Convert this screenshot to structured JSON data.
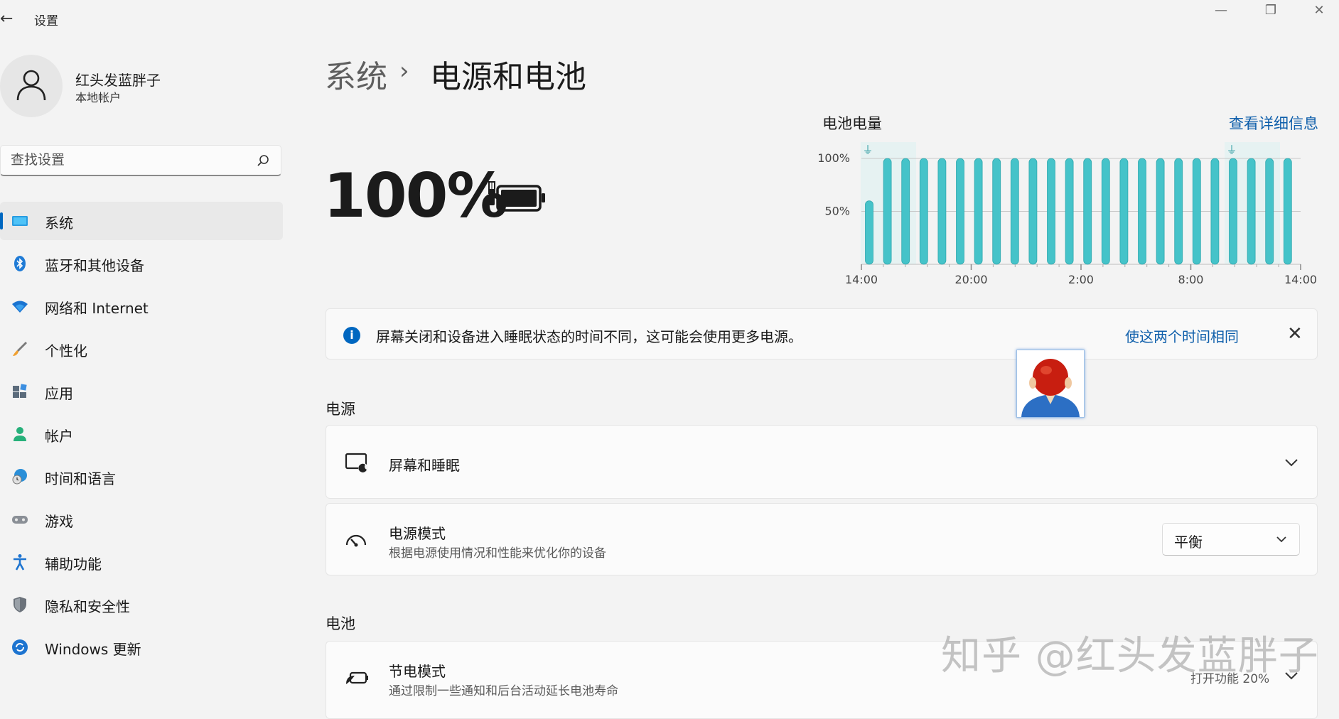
{
  "window": {
    "title": "设置",
    "back_glyph": "←",
    "minimize_glyph": "—",
    "restore_glyph": "❐",
    "close_glyph": "✕"
  },
  "user": {
    "name": "红头发蓝胖子",
    "account_type": "本地帐户"
  },
  "search": {
    "placeholder": "查找设置"
  },
  "sidebar": {
    "items": [
      {
        "label": "系统",
        "icon": "monitor-icon",
        "active": true
      },
      {
        "label": "蓝牙和其他设备",
        "icon": "bluetooth-icon"
      },
      {
        "label": "网络和 Internet",
        "icon": "wifi-icon"
      },
      {
        "label": "个性化",
        "icon": "brush-icon"
      },
      {
        "label": "应用",
        "icon": "apps-icon"
      },
      {
        "label": "帐户",
        "icon": "person-icon"
      },
      {
        "label": "时间和语言",
        "icon": "globe-clock-icon"
      },
      {
        "label": "游戏",
        "icon": "gamepad-icon"
      },
      {
        "label": "辅助功能",
        "icon": "accessibility-icon"
      },
      {
        "label": "隐私和安全性",
        "icon": "shield-icon"
      },
      {
        "label": "Windows 更新",
        "icon": "update-icon"
      }
    ]
  },
  "breadcrumb": {
    "parent": "系统",
    "separator": "›",
    "current": "电源和电池"
  },
  "battery": {
    "percent_text": "100%",
    "charging": true
  },
  "chart_data": {
    "type": "bar",
    "title": "电池电量",
    "link_label": "查看详细信息",
    "y_ticks": [
      "100%",
      "50%"
    ],
    "ylim": [
      0,
      100
    ],
    "x_ticks": [
      "14:00",
      "20:00",
      "2:00",
      "8:00",
      "14:00"
    ],
    "values": [
      60,
      100,
      100,
      100,
      100,
      100,
      100,
      100,
      100,
      100,
      100,
      100,
      100,
      100,
      100,
      100,
      100,
      100,
      100,
      100,
      100,
      100,
      100,
      100
    ],
    "plugged_in_markers": [
      0,
      20
    ],
    "color": "#45c3c9"
  },
  "info_bar": {
    "message": "屏幕关闭和设备进入睡眠状态的时间不同，这可能会使用更多电源。",
    "action": "使这两个时间相同",
    "close_glyph": "✕"
  },
  "power_section": {
    "heading": "电源",
    "screen_sleep": {
      "title": "屏幕和睡眠"
    },
    "power_mode": {
      "title": "电源模式",
      "description": "根据电源使用情况和性能来优化你的设备",
      "selected": "平衡"
    }
  },
  "battery_section": {
    "heading": "电池",
    "battery_saver": {
      "title": "节电模式",
      "description": "通过限制一些通知和后台活动延长电池寿命",
      "status": "打开功能 20%"
    }
  },
  "watermark": "知乎 @红头发蓝胖子",
  "colors": {
    "accent": "#0067c0",
    "link": "#0f5fab",
    "bar": "#45c3c9"
  }
}
